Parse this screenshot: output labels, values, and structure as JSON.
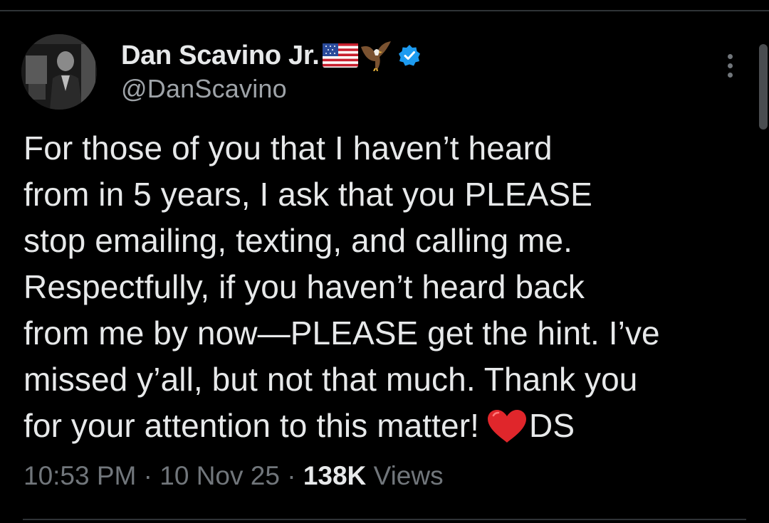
{
  "author": {
    "display_name": "Dan Scavino Jr.",
    "name_emoji_icons": [
      "us-flag-icon",
      "eagle-icon"
    ],
    "verified_icon": "verified-badge-icon",
    "verified_color": "#1d9bf0",
    "handle": "@DanScavino"
  },
  "actions": {
    "more_icon": "more-vertical-icon"
  },
  "tweet": {
    "lines": [
      "For those of you that I haven’t heard",
      "from in 5 years, I ask that you PLEASE",
      "stop emailing, texting, and calling me.",
      "Respectfully, if you haven’t heard back",
      "from me by now—PLEASE get the hint. I’ve",
      "missed y’all, but not that much. Thank you",
      "for your attention to this matter!",
      "DS"
    ],
    "heart_icon": "red-heart-icon"
  },
  "meta": {
    "time": "10:53 PM",
    "separator": "·",
    "date": "10 Nov 25",
    "views_count": "138K",
    "views_label": "Views"
  },
  "colors": {
    "background": "#000000",
    "text_primary": "#e7e9ea",
    "text_secondary": "#71767b",
    "divider": "#2f3336",
    "heart": "#e0262b"
  }
}
